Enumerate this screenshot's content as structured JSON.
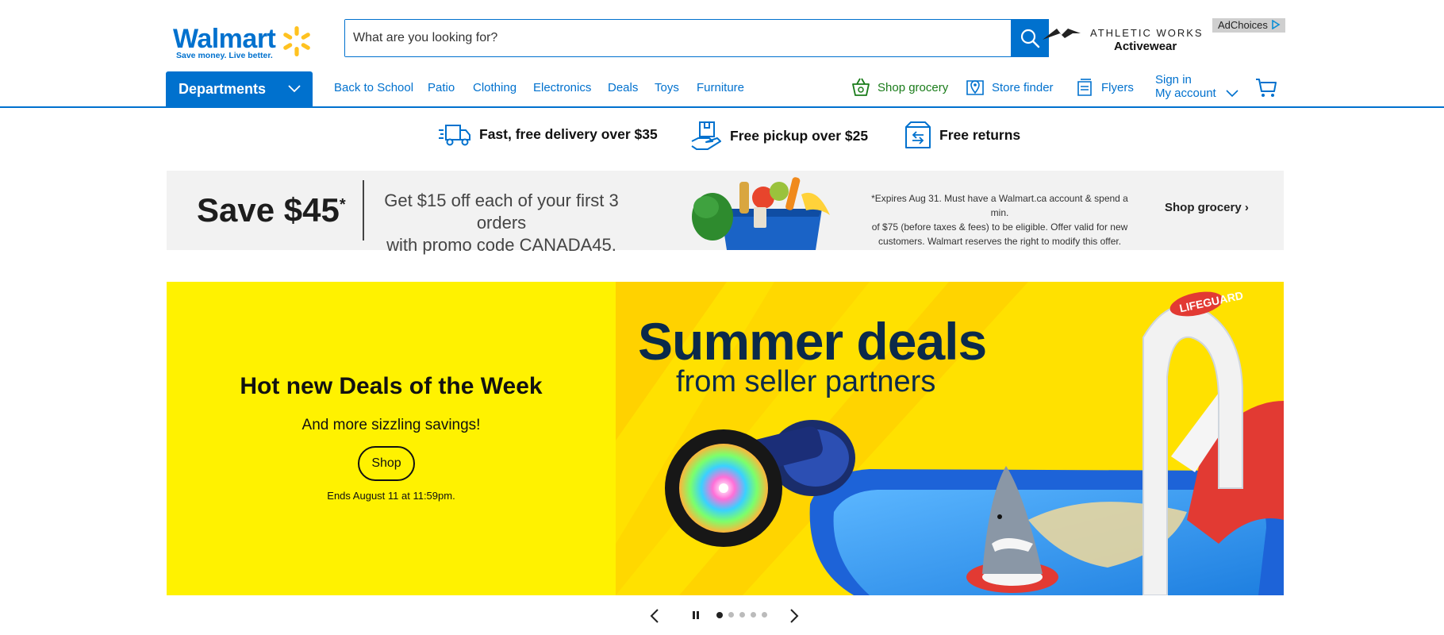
{
  "header": {
    "logo_text": "Walmart",
    "logo_tagline": "Save money. Live better.",
    "search_placeholder": "What are you looking for?",
    "ad_brand": "ATHLETIC WORKS",
    "ad_subtitle": "Activewear",
    "adchoices_label": "AdChoices"
  },
  "nav": {
    "departments_label": "Departments",
    "links": [
      "Back to School",
      "Patio",
      "Clothing",
      "Electronics",
      "Deals",
      "Toys",
      "Furniture"
    ],
    "shop_grocery": "Shop grocery",
    "store_finder": "Store finder",
    "flyers": "Flyers",
    "sign_in": "Sign in",
    "my_account": "My account"
  },
  "perks": {
    "delivery": "Fast, free delivery over $35",
    "pickup": "Free pickup over $25",
    "returns": "Free returns"
  },
  "promo": {
    "save_amount": "Save $45",
    "asterisk": "*",
    "offer_line1": "Get $15 off each of your first 3 orders",
    "offer_line2": "with promo code CANADA45.",
    "fine_print_line1": "*Expires Aug 31. Must have a Walmart.ca account & spend a min.",
    "fine_print_line2": "of $75 (before taxes & fees) to be eligible. Offer valid for new",
    "fine_print_line3": "customers. Walmart reserves the right to modify this offer.",
    "cta": "Shop grocery ›"
  },
  "hero": {
    "title": "Hot new Deals of the Week",
    "subtitle": "And more sizzling savings!",
    "button": "Shop",
    "ends": "Ends August 11 at 11:59pm.",
    "image_title": "Summer deals",
    "image_subtitle": "from seller partners",
    "lifeguard_text": "LIFEGUARD"
  },
  "carousel": {
    "active_index": 0,
    "slide_count": 5
  },
  "colors": {
    "brand_blue": "#0071ce",
    "spark_yellow": "#ffc220",
    "hero_yellow": "#fff200",
    "grocery_green": "#1a7c1a"
  }
}
